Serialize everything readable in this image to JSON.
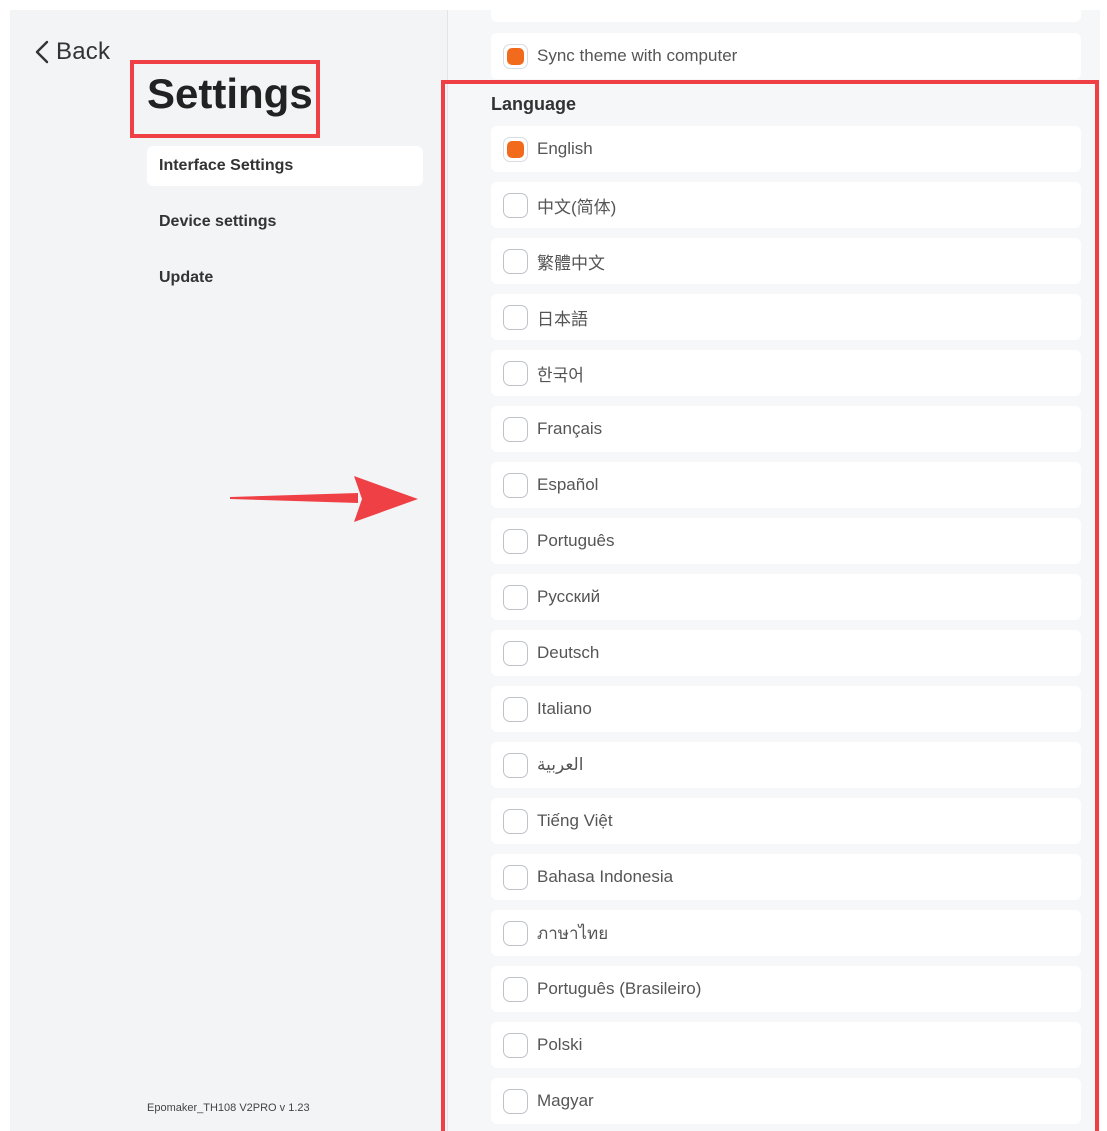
{
  "sidebar": {
    "back_label": "Back",
    "title": "Settings",
    "nav": [
      {
        "label": "Interface Settings",
        "active": true
      },
      {
        "label": "Device settings",
        "active": false
      },
      {
        "label": "Update",
        "active": false
      }
    ],
    "version": "Epomaker_TH108 V2PRO v 1.23"
  },
  "content": {
    "sync_theme": {
      "label": "Sync theme with computer",
      "checked": true
    },
    "language_section_title": "Language",
    "languages": [
      {
        "label": "English",
        "checked": true
      },
      {
        "label": "中文(简体)",
        "checked": false
      },
      {
        "label": "繁體中文",
        "checked": false
      },
      {
        "label": "日本語",
        "checked": false
      },
      {
        "label": "한국어",
        "checked": false
      },
      {
        "label": "Français",
        "checked": false
      },
      {
        "label": "Español",
        "checked": false
      },
      {
        "label": "Português",
        "checked": false
      },
      {
        "label": "Русский",
        "checked": false
      },
      {
        "label": "Deutsch",
        "checked": false
      },
      {
        "label": "Italiano",
        "checked": false
      },
      {
        "label": "العربية",
        "checked": false
      },
      {
        "label": "Tiếng Việt",
        "checked": false
      },
      {
        "label": "Bahasa Indonesia",
        "checked": false
      },
      {
        "label": "ภาษาไทย",
        "checked": false
      },
      {
        "label": "Português (Brasileiro)",
        "checked": false
      },
      {
        "label": "Polski",
        "checked": false
      },
      {
        "label": "Magyar",
        "checked": false
      }
    ]
  },
  "colors": {
    "accent": "#f26a1b",
    "annotation": "#ef4045"
  },
  "icons": {
    "back": "chevron-left-icon",
    "annotation_arrow": "right-arrow-icon"
  }
}
